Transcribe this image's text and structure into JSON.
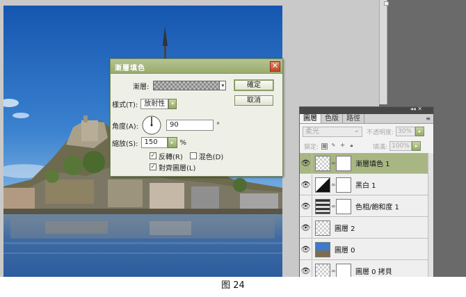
{
  "dialog": {
    "title": "漸層填色",
    "gradient_label": "漸層:",
    "style_label": "樣式(T):",
    "style_value": "放射性",
    "angle_label": "角度(A):",
    "angle_value": "90",
    "angle_unit": "°",
    "scale_label": "縮放(S):",
    "scale_value": "150",
    "scale_unit": "%",
    "reverse_label": "反轉(R)",
    "reverse_checked": "✓",
    "dither_label": "混色(D)",
    "align_label": "對齊圖層(L)",
    "align_checked": "✓",
    "ok_label": "確定",
    "cancel_label": "取消",
    "close_glyph": "✕"
  },
  "layers_panel": {
    "collapse_glyph": "◂◂ ✕",
    "tabs": [
      "圖層",
      "色版",
      "路徑"
    ],
    "menu_glyph": "≡",
    "blend_mode": "柔光",
    "opacity_label": "不透明度:",
    "opacity_value": "30%",
    "lock_label": "鎖定:",
    "fill_label": "填滿:",
    "fill_value": "100%",
    "layers": [
      {
        "name": "漸層填色 1",
        "selected": true
      },
      {
        "name": "黑白 1",
        "selected": false
      },
      {
        "name": "色相/飽和度 1",
        "selected": false
      },
      {
        "name": "圖層 2",
        "selected": false
      },
      {
        "name": "圖層 0",
        "selected": false
      },
      {
        "name": "圖層 0 拷貝",
        "selected": false
      }
    ]
  },
  "caption": "图 24",
  "colors": {
    "accent": "#9aab70",
    "selected_layer": "#a8b684",
    "sky": "#1e63b8"
  }
}
